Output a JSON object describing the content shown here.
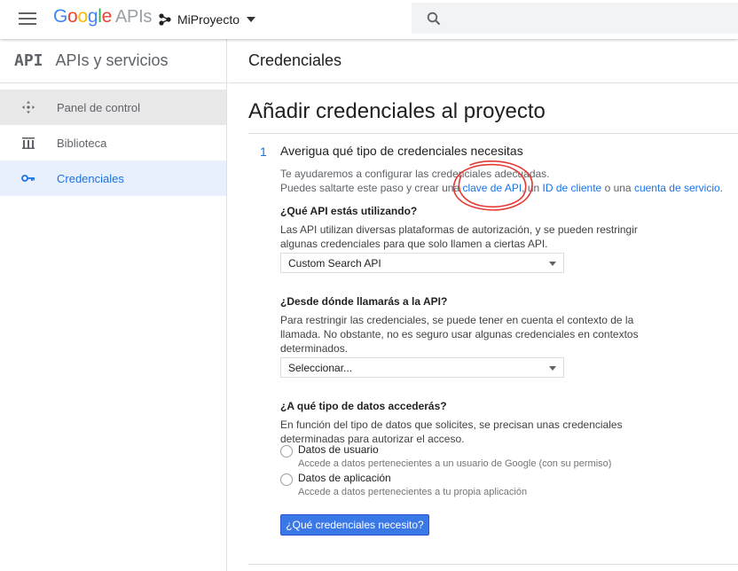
{
  "topbar": {
    "logo_google": "Google",
    "logo_apis": "APIs",
    "project_name": "MiProyecto",
    "menu_icon": "hamburger-menu-icon",
    "search_icon": "search-icon"
  },
  "sidebar": {
    "badge": "API",
    "title": "APIs y servicios",
    "items": [
      {
        "label": "Panel de control",
        "icon": "dashboard-icon"
      },
      {
        "label": "Biblioteca",
        "icon": "library-icon"
      },
      {
        "label": "Credenciales",
        "icon": "key-icon"
      }
    ]
  },
  "main": {
    "header": "Credenciales",
    "title": "Añadir credenciales al proyecto",
    "step": {
      "number": "1",
      "title": "Averigua qué tipo de credenciales necesitas",
      "intro_line1": "Te ayudaremos a configurar las credenciales adecuadas.",
      "intro_line2_pre": "Puedes saltarte este paso y crear una ",
      "link_api_key": "clave de API",
      "sep1": ", un ",
      "link_client_id": "ID de cliente",
      "sep2": " o una ",
      "link_service_account": "cuenta de servicio",
      "intro_end": "."
    },
    "q1": {
      "question": "¿Qué API estás utilizando?",
      "desc_line1": "Las API utilizan diversas plataformas de autorización, y se pueden restringir",
      "desc_line2": "algunas credenciales para que solo llamen a ciertas API.",
      "selected": "Custom Search API"
    },
    "q2": {
      "question": "¿Desde dónde llamarás a la API?",
      "desc_line1": "Para restringir las credenciales, se puede tener en cuenta el contexto de la",
      "desc_line2": "llamada. No obstante, no es seguro usar algunas credenciales en contextos",
      "desc_line3": "determinados.",
      "selected": "Seleccionar..."
    },
    "q3": {
      "question": "¿A qué tipo de datos accederás?",
      "desc_line1": "En función del tipo de datos que solicites, se precisan unas credenciales",
      "desc_line2": "determinadas para autorizar el acceso.",
      "options": [
        {
          "label": "Datos de usuario",
          "sub": "Accede a datos pertenecientes a un usuario de Google (con su permiso)"
        },
        {
          "label": "Datos de aplicación",
          "sub": "Accede a datos pertenecientes a tu propia aplicación"
        }
      ]
    },
    "button_label": "¿Qué credenciales necesito?"
  },
  "colors": {
    "accent": "#1a73e8",
    "button": "#3b78e7",
    "annotation": "#e53935"
  }
}
